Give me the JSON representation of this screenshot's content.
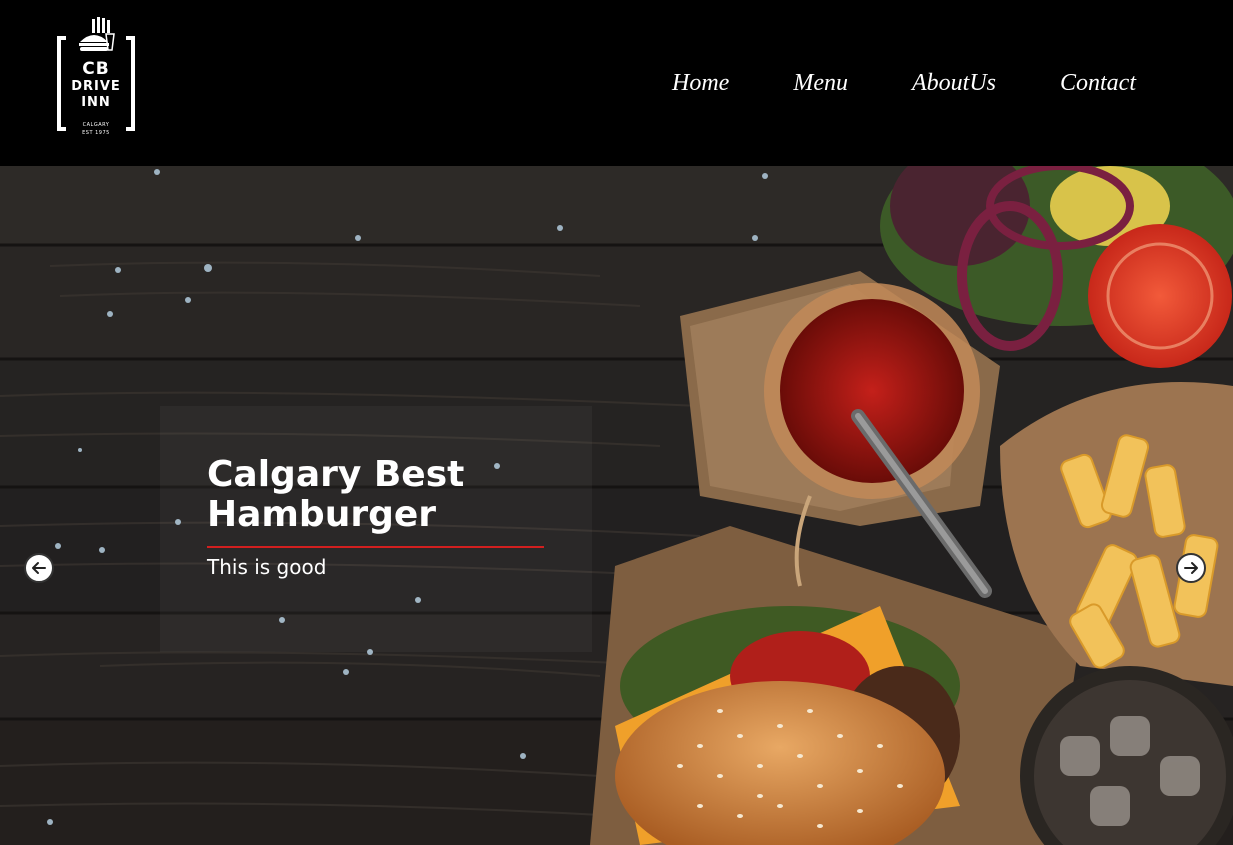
{
  "logo": {
    "line1": "CB",
    "line2": "DRIVE",
    "line3": "INN",
    "line4": "CALGARY",
    "line5": "EST 1975"
  },
  "nav": {
    "items": [
      "Home",
      "Menu",
      "AboutUs",
      "Contact"
    ]
  },
  "hero": {
    "title": "Calgary Best Hamburger",
    "subtitle": "This is good",
    "prev_icon": "arrow-left-icon",
    "next_icon": "arrow-right-icon"
  },
  "colors": {
    "header_bg": "#000000",
    "accent_underline": "#d21f1f",
    "text": "#ffffff"
  }
}
